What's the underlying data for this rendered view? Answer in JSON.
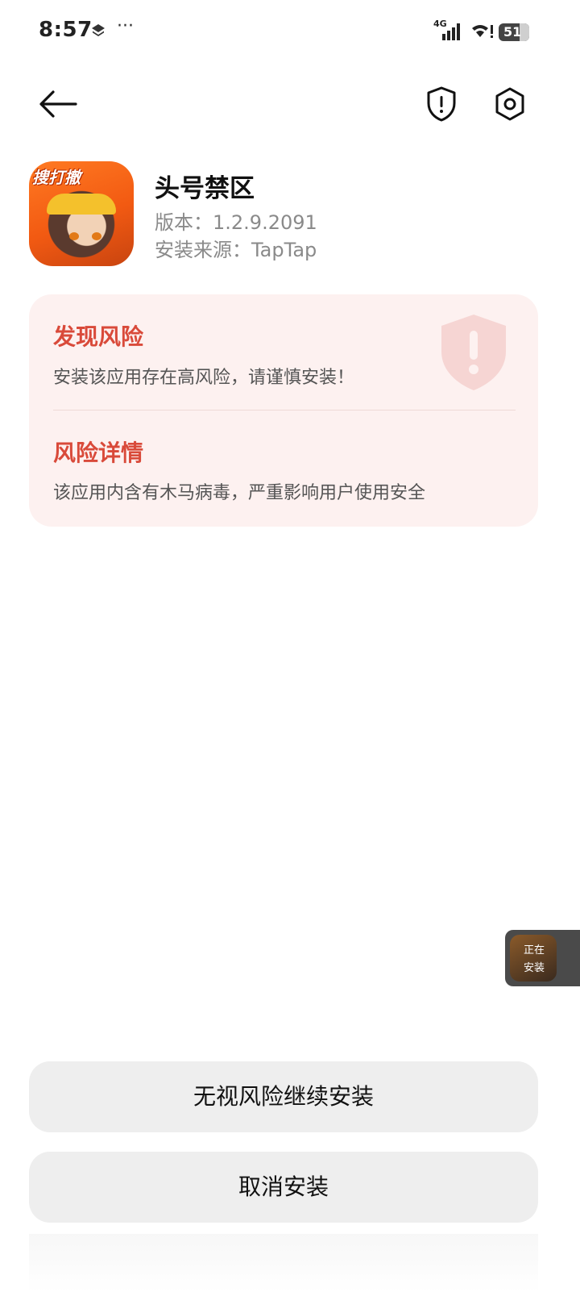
{
  "status_bar": {
    "time": "8:57",
    "overflow": "···",
    "network": "4G",
    "battery": "51",
    "icons": [
      "layers-icon",
      "signal-icon",
      "wifi-icon",
      "battery-icon"
    ]
  },
  "header": {
    "icons": [
      "back-arrow-icon",
      "shield-alert-icon",
      "settings-icon"
    ]
  },
  "app": {
    "name": "头号禁区",
    "version": "版本：1.2.9.2091",
    "source": "安装来源：TapTap",
    "icon_badge": "搜打撤"
  },
  "risk": {
    "title": "发现风险",
    "description": "安装该应用存在高风险，请谨慎安装！",
    "detail_title": "风险详情",
    "detail_description": "该应用内含有木马病毒，严重影响用户使用安全",
    "accent_color": "#d94a3a",
    "card_color": "#fdf1f0"
  },
  "installing_widget": {
    "line1": "正在",
    "line2": "安装"
  },
  "actions": {
    "continue_label": "无视风险继续安装",
    "cancel_label": "取消安装"
  }
}
